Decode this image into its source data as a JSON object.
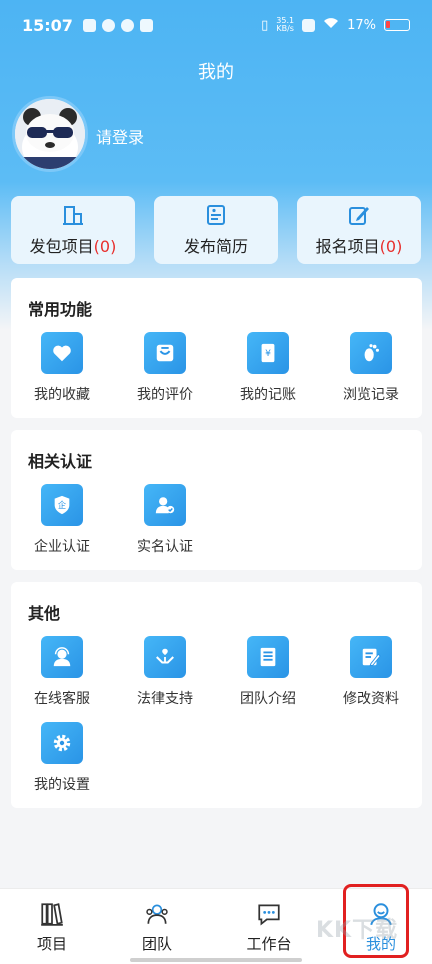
{
  "status_bar": {
    "time": "15:07",
    "net_speed_top": "35.1",
    "net_speed_bottom": "KB/s",
    "battery": "17%"
  },
  "header": {
    "title": "我的",
    "login": "请登录"
  },
  "quick": [
    {
      "label": "发包项目",
      "count": "(0)",
      "icon": "building-icon"
    },
    {
      "label": "发布简历",
      "count": "",
      "icon": "resume-icon"
    },
    {
      "label": "报名项目",
      "count": "(0)",
      "icon": "edit-icon"
    }
  ],
  "common": {
    "title": "常用功能",
    "items": [
      {
        "label": "我的收藏",
        "icon": "heart-icon"
      },
      {
        "label": "我的评价",
        "icon": "comment-icon"
      },
      {
        "label": "我的记账",
        "icon": "yen-icon"
      },
      {
        "label": "浏览记录",
        "icon": "footprint-icon"
      }
    ]
  },
  "auth": {
    "title": "相关认证",
    "items": [
      {
        "label": "企业认证",
        "icon": "enterprise-shield-icon"
      },
      {
        "label": "实名认证",
        "icon": "user-check-icon"
      }
    ]
  },
  "other": {
    "title": "其他",
    "items": [
      {
        "label": "在线客服",
        "icon": "customer-service-icon"
      },
      {
        "label": "法律支持",
        "icon": "hands-icon"
      },
      {
        "label": "团队介绍",
        "icon": "document-icon"
      },
      {
        "label": "修改资料",
        "icon": "edit-doc-icon"
      },
      {
        "label": "我的设置",
        "icon": "gear-icon"
      }
    ]
  },
  "nav": [
    {
      "label": "项目",
      "icon": "books-icon"
    },
    {
      "label": "团队",
      "icon": "team-icon"
    },
    {
      "label": "工作台",
      "icon": "chat-icon"
    },
    {
      "label": "我的",
      "icon": "profile-icon"
    }
  ],
  "colors": {
    "accent": "#4db4f3",
    "icon_blue": "#2a94e6",
    "count_red": "#e8302e",
    "highlight": "#e12020"
  },
  "watermark": "KK下载"
}
